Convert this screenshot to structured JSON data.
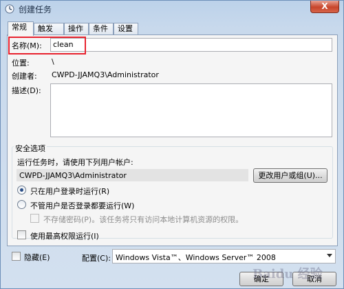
{
  "window": {
    "title": "创建任务",
    "close_label": "X"
  },
  "tabs": [
    {
      "label": "常规"
    },
    {
      "label": "触发器"
    },
    {
      "label": "操作"
    },
    {
      "label": "条件"
    },
    {
      "label": "设置"
    }
  ],
  "general": {
    "name_label": "名称(M):",
    "name_value": "clean",
    "location_label": "位置:",
    "location_value": "\\",
    "author_label": "创建者:",
    "author_value": "CWPD-JJAMQ3\\Administrator",
    "description_label": "描述(D):",
    "description_value": ""
  },
  "security": {
    "group_title": "安全选项",
    "run_as_label": "运行任务时，请使用下列用户帐户:",
    "user_account": "CWPD-JJAMQ3\\Administrator",
    "change_user_button": "更改用户或组(U)...",
    "radio_logged_on": "只在用户登录时运行(R)",
    "radio_whether_logged": "不管用户是否登录都要运行(W)",
    "do_not_store_password": "不存储密码(P)。该任务将只有访问本地计算机资源的权限。",
    "highest_privileges": "使用最高权限运行(I)"
  },
  "footer": {
    "hidden_label": "隐藏(E)",
    "configure_label": "配置(C):",
    "configure_value": "Windows Vista™、Windows Server™ 2008",
    "ok_button": "确定",
    "cancel_button": "取消"
  },
  "watermark": {
    "text": "Baidu 经验"
  },
  "colors": {
    "highlight": "#e8222e",
    "title_bar": "#bcd2ea"
  }
}
